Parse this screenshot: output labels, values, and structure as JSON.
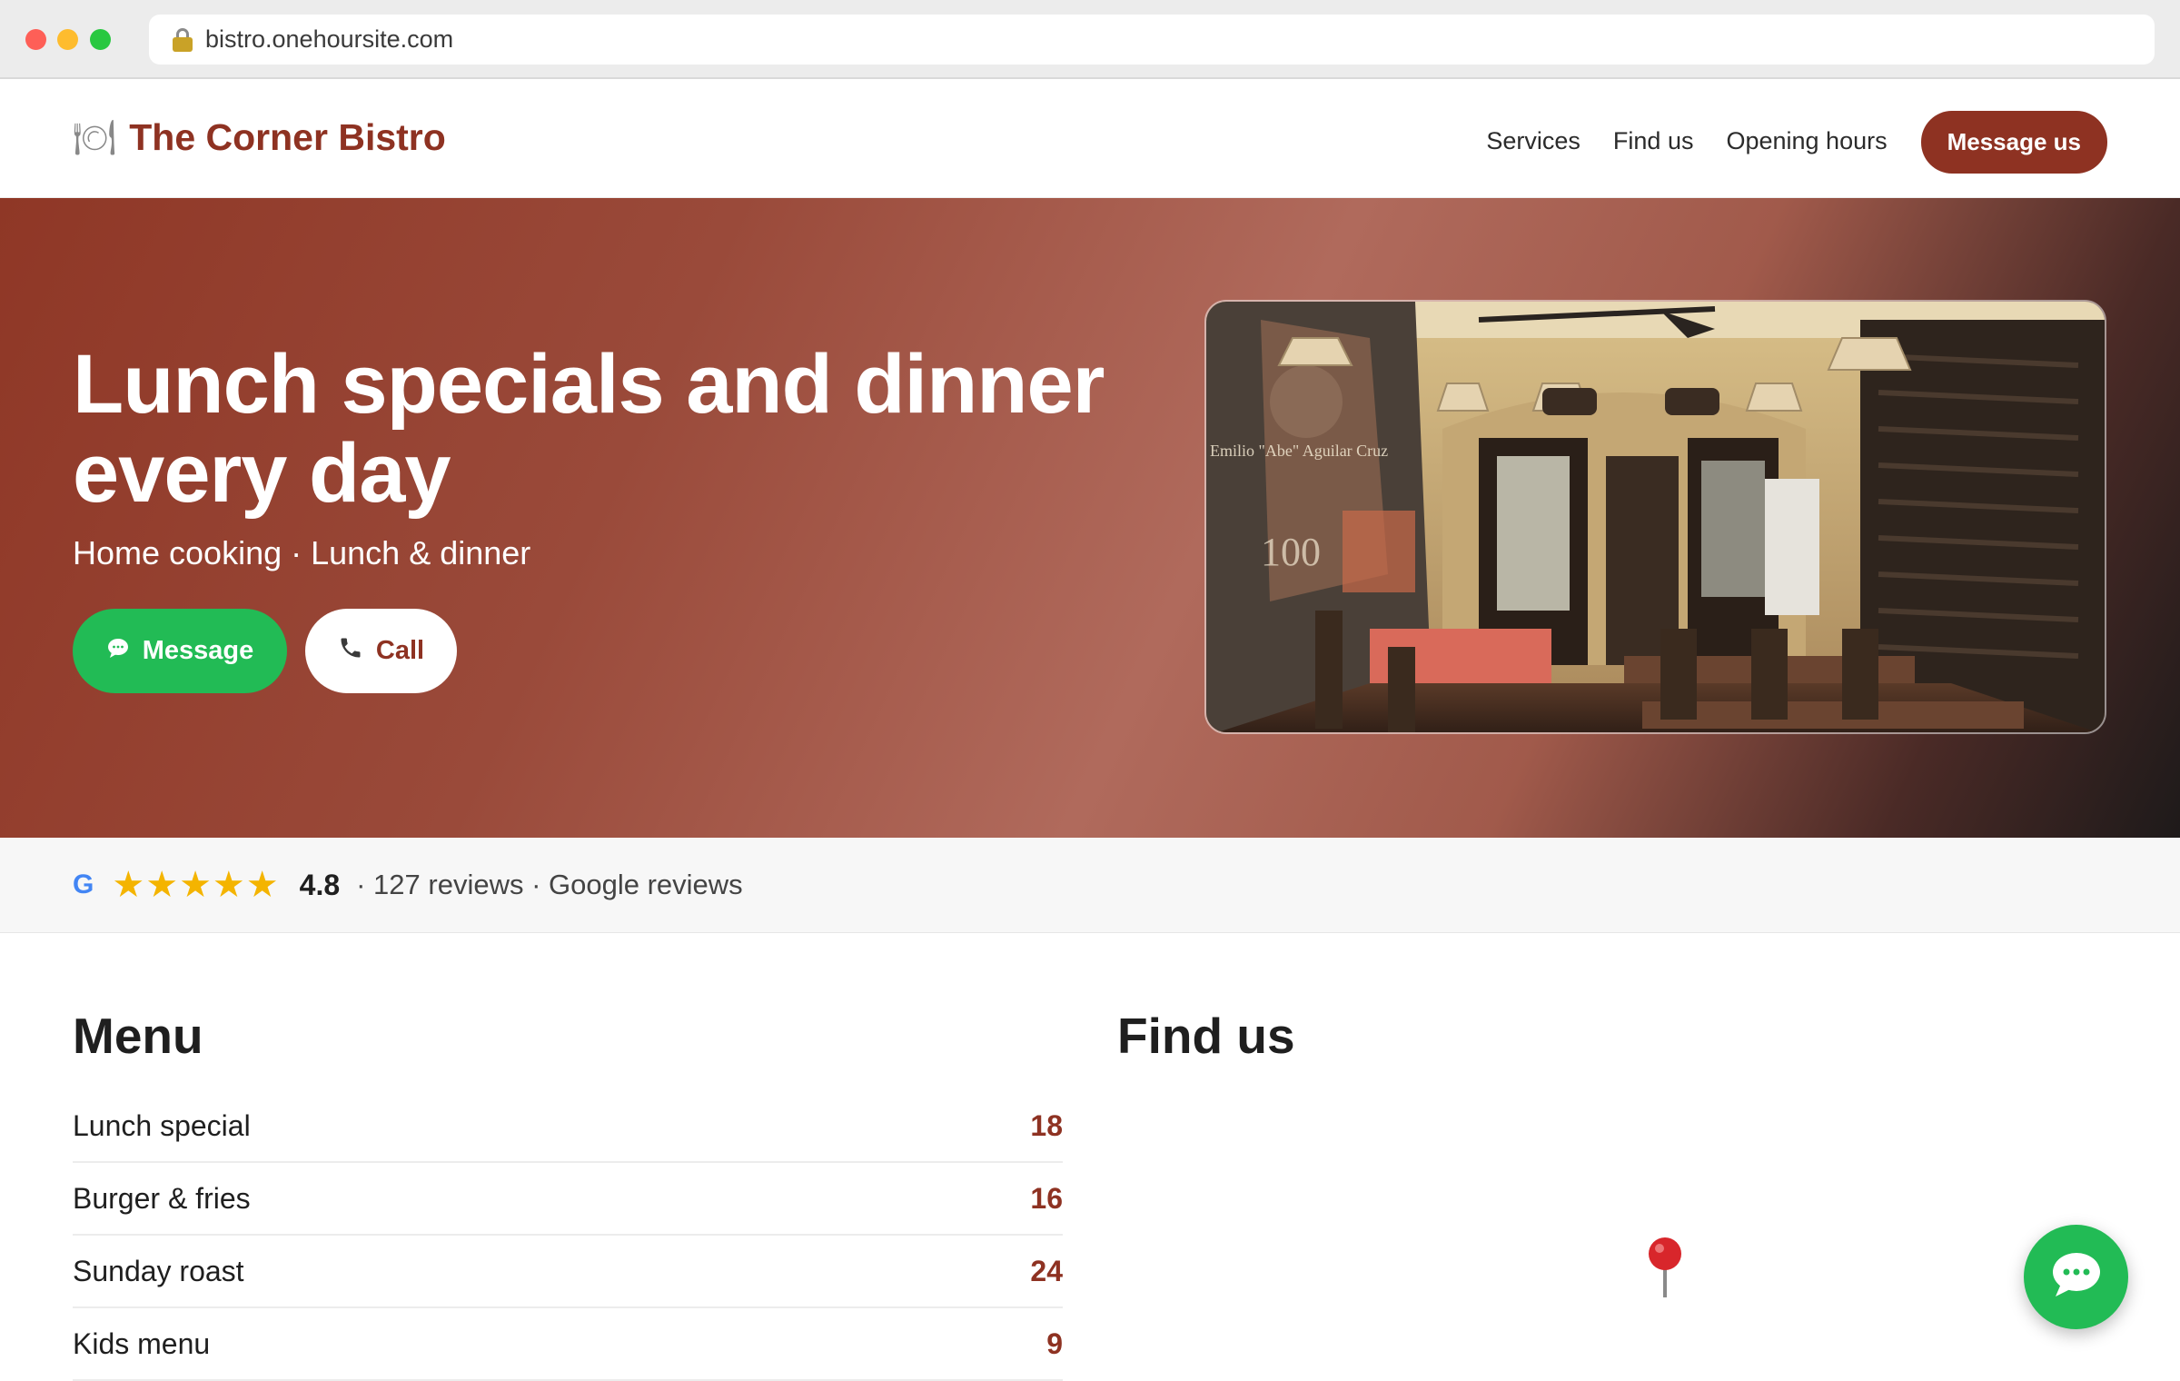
{
  "browser": {
    "url": "bistro.onehoursite.com"
  },
  "header": {
    "brand_icon": "plate-icon",
    "brand_name": "The Corner Bistro",
    "nav": [
      "Services",
      "Find us",
      "Opening hours"
    ],
    "cta_label": "Message us"
  },
  "hero": {
    "title": "Lunch specials and dinner every day",
    "subtitle": "Home cooking · Lunch & dinner",
    "message_label": "Message",
    "call_label": "Call",
    "photo_icon": "restaurant-interior-photo"
  },
  "reviews": {
    "source_logo": "G",
    "stars": "★★★★★",
    "rating": "4.8",
    "meta": "· 127 reviews · Google reviews"
  },
  "menu": {
    "title": "Menu",
    "items": [
      {
        "name": "Lunch special",
        "price": "18"
      },
      {
        "name": "Burger & fries",
        "price": "16"
      },
      {
        "name": "Sunday roast",
        "price": "24"
      },
      {
        "name": "Kids menu",
        "price": "9"
      }
    ]
  },
  "find_us": {
    "title": "Find us",
    "pin_icon": "map-pin-icon"
  },
  "chat_fab_icon": "chat-bubble-icon",
  "colors": {
    "brand": "#8e3222",
    "whatsapp_green": "#22bb55",
    "star": "#f4b400"
  }
}
